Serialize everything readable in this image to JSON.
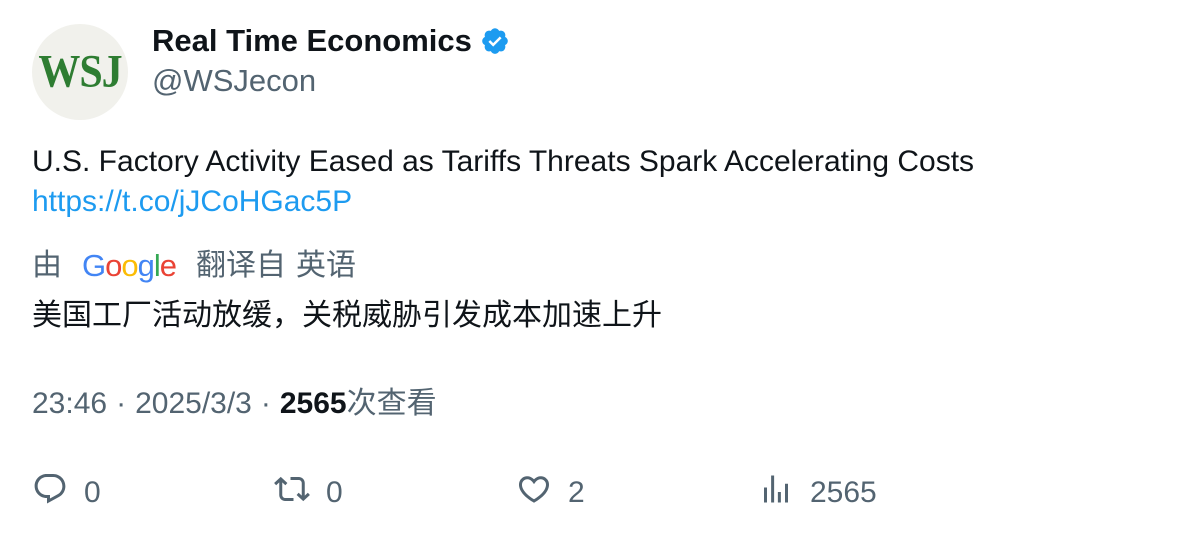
{
  "author": {
    "avatar_text": "WSJ",
    "display_name": "Real Time Economics",
    "handle": "@WSJecon",
    "verified_icon": "verified-badge-icon"
  },
  "tweet": {
    "text": "U.S. Factory Activity Eased as Tariffs Threats Spark Accelerating Costs",
    "link": "https://t.co/jJCoHGac5P"
  },
  "translation": {
    "prefix": "由",
    "provider": "Google",
    "suffix": "翻译自",
    "language": "英语",
    "text": "美国工厂活动放缓，关税威胁引发成本加速上升"
  },
  "meta": {
    "time": "23:46",
    "separator": "·",
    "date": "2025/3/3",
    "views_count": "2565",
    "views_label": "次查看"
  },
  "actions": {
    "reply_count": "0",
    "retweet_count": "0",
    "like_count": "2",
    "views_count": "2565"
  },
  "colors": {
    "link": "#1d9bf0",
    "secondary_text": "#536471",
    "verified": "#1d9bf0",
    "avatar_brand": "#2e7d32"
  }
}
